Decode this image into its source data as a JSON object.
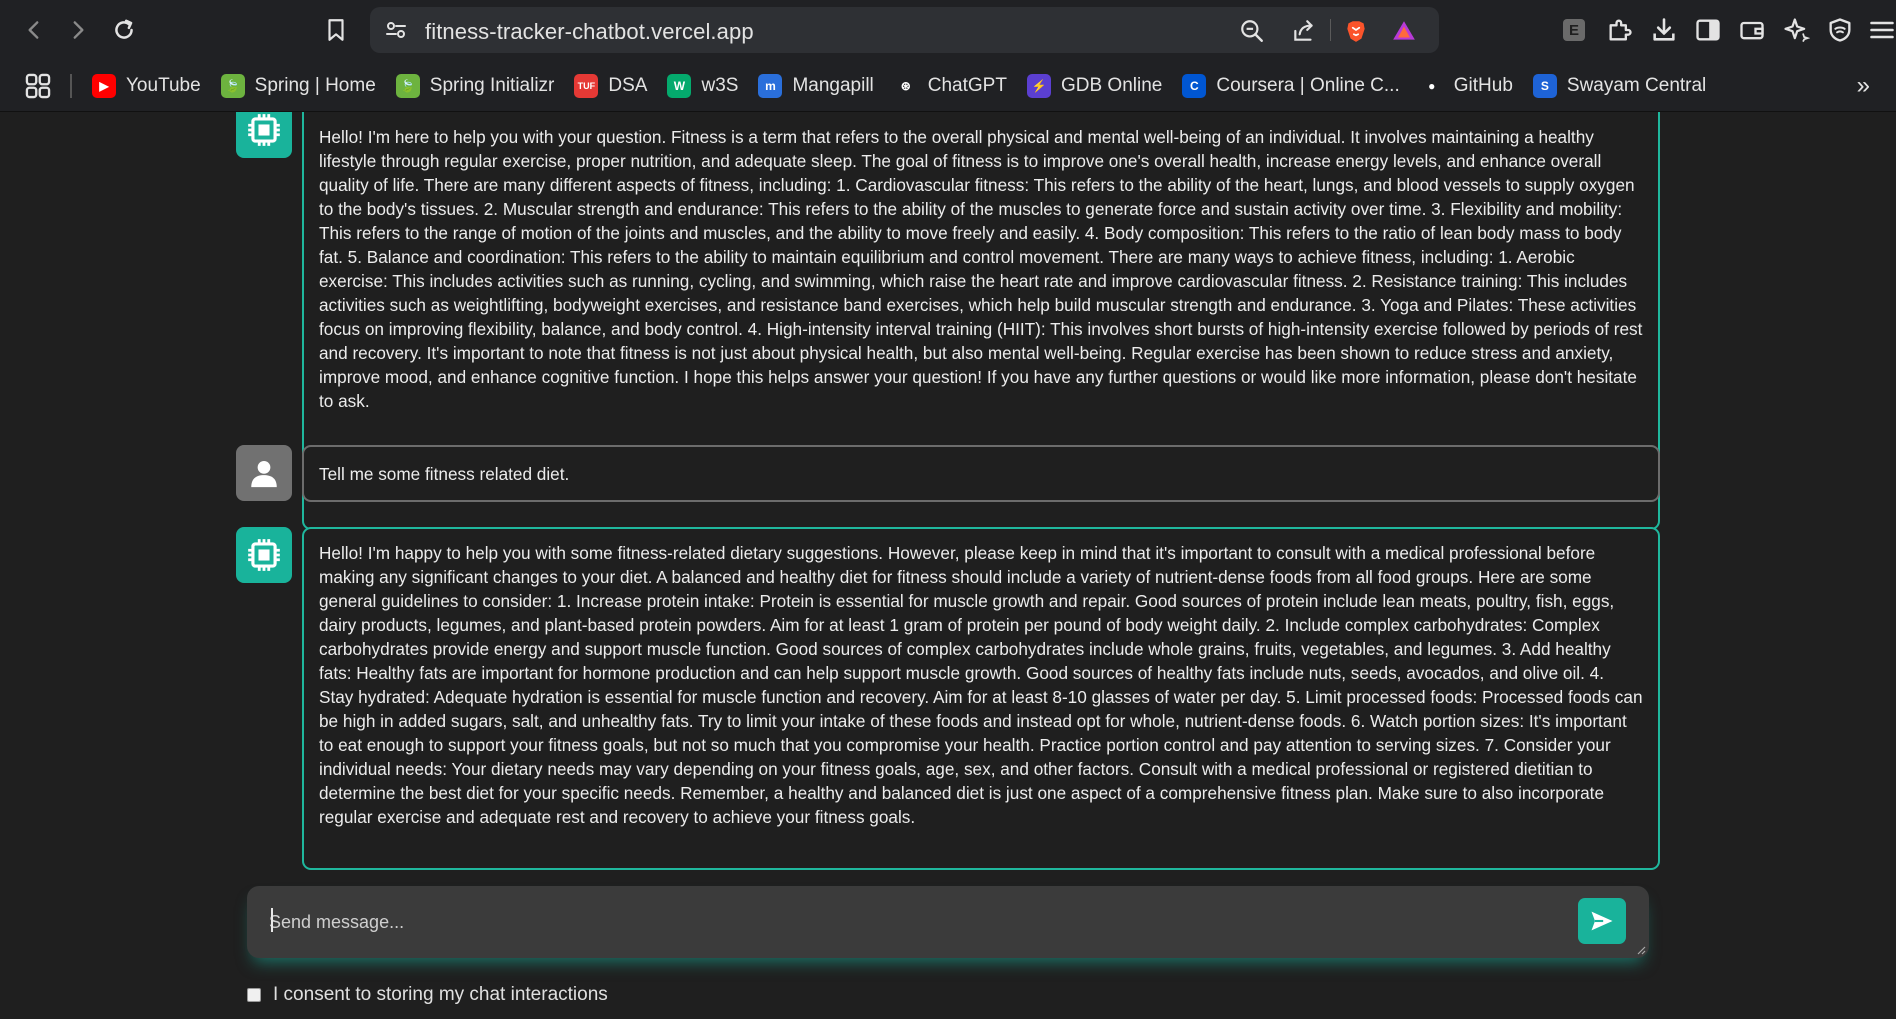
{
  "browser": {
    "url": "fitness-tracker-chatbot.vercel.app",
    "bookmarks": [
      {
        "label": "YouTube",
        "icon": "youtube-icon",
        "color": "#ff0000",
        "glyph": "▶"
      },
      {
        "label": "Spring | Home",
        "icon": "spring-icon",
        "color": "#6db33f",
        "glyph": "🍃"
      },
      {
        "label": "Spring Initializr",
        "icon": "spring-icon",
        "color": "#6db33f",
        "glyph": "🍃"
      },
      {
        "label": "DSA",
        "icon": "tuf-icon",
        "color": "#e53935",
        "glyph": "TUF"
      },
      {
        "label": "w3S",
        "icon": "w3schools-icon",
        "color": "#04aa6d",
        "glyph": "W"
      },
      {
        "label": "Mangapill",
        "icon": "mangapill-icon",
        "color": "#2a6fdb",
        "glyph": "m"
      },
      {
        "label": "ChatGPT",
        "icon": "chatgpt-icon",
        "color": "#ffffff",
        "glyph": "⊛"
      },
      {
        "label": "GDB Online",
        "icon": "gdb-icon",
        "color": "#5b3fd1",
        "glyph": "⚡"
      },
      {
        "label": "Coursera | Online C...",
        "icon": "coursera-icon",
        "color": "#0056d2",
        "glyph": "C"
      },
      {
        "label": "GitHub",
        "icon": "github-icon",
        "color": "#ffffff",
        "glyph": "●"
      },
      {
        "label": "Swayam Central",
        "icon": "swayam-icon",
        "color": "#1e63d6",
        "glyph": "S"
      }
    ]
  },
  "chat": {
    "messages": [
      {
        "role": "bot",
        "text": "Hello! I'm here to help you with your question. Fitness is a term that refers to the overall physical and mental well-being of an individual. It involves maintaining a healthy lifestyle through regular exercise, proper nutrition, and adequate sleep. The goal of fitness is to improve one's overall health, increase energy levels, and enhance overall quality of life. There are many different aspects of fitness, including: 1. Cardiovascular fitness: This refers to the ability of the heart, lungs, and blood vessels to supply oxygen to the body's tissues. 2. Muscular strength and endurance: This refers to the ability of the muscles to generate force and sustain activity over time. 3. Flexibility and mobility: This refers to the range of motion of the joints and muscles, and the ability to move freely and easily. 4. Body composition: This refers to the ratio of lean body mass to body fat. 5. Balance and coordination: This refers to the ability to maintain equilibrium and control movement. There are many ways to achieve fitness, including: 1. Aerobic exercise: This includes activities such as running, cycling, and swimming, which raise the heart rate and improve cardiovascular fitness. 2. Resistance training: This includes activities such as weightlifting, bodyweight exercises, and resistance band exercises, which help build muscular strength and endurance. 3. Yoga and Pilates: These activities focus on improving flexibility, balance, and body control. 4. High-intensity interval training (HIIT): This involves short bursts of high-intensity exercise followed by periods of rest and recovery. It's important to note that fitness is not just about physical health, but also mental well-being. Regular exercise has been shown to reduce stress and anxiety, improve mood, and enhance cognitive function. I hope this helps answer your question! If you have any further questions or would like more information, please don't hesitate to ask."
      },
      {
        "role": "user",
        "text": "Tell me some fitness related diet."
      },
      {
        "role": "bot",
        "text": "Hello! I'm happy to help you with some fitness-related dietary suggestions. However, please keep in mind that it's important to consult with a medical professional before making any significant changes to your diet. A balanced and healthy diet for fitness should include a variety of nutrient-dense foods from all food groups. Here are some general guidelines to consider: 1. Increase protein intake: Protein is essential for muscle growth and repair. Good sources of protein include lean meats, poultry, fish, eggs, dairy products, legumes, and plant-based protein powders. Aim for at least 1 gram of protein per pound of body weight daily. 2. Include complex carbohydrates: Complex carbohydrates provide energy and support muscle function. Good sources of complex carbohydrates include whole grains, fruits, vegetables, and legumes. 3. Add healthy fats: Healthy fats are important for hormone production and can help support muscle growth. Good sources of healthy fats include nuts, seeds, avocados, and olive oil. 4. Stay hydrated: Adequate hydration is essential for muscle function and recovery. Aim for at least 8-10 glasses of water per day. 5. Limit processed foods: Processed foods can be high in added sugars, salt, and unhealthy fats. Try to limit your intake of these foods and instead opt for whole, nutrient-dense foods. 6. Watch portion sizes: It's important to eat enough to support your fitness goals, but not so much that you compromise your health. Practice portion control and pay attention to serving sizes. 7. Consider your individual needs: Your dietary needs may vary depending on your fitness goals, age, sex, and other factors. Consult with a medical professional or registered dietitian to determine the best diet for your specific needs. Remember, a healthy and balanced diet is just one aspect of a comprehensive fitness plan. Make sure to also incorporate regular exercise and adequate rest and recovery to achieve your fitness goals."
      }
    ],
    "input": {
      "placeholder": "Send message...",
      "value": ""
    },
    "consent_label": "I consent to storing my chat interactions",
    "consent_checked": false
  },
  "colors": {
    "accent": "#19b39b",
    "background": "#1f1f1f",
    "user_avatar": "#717171"
  }
}
